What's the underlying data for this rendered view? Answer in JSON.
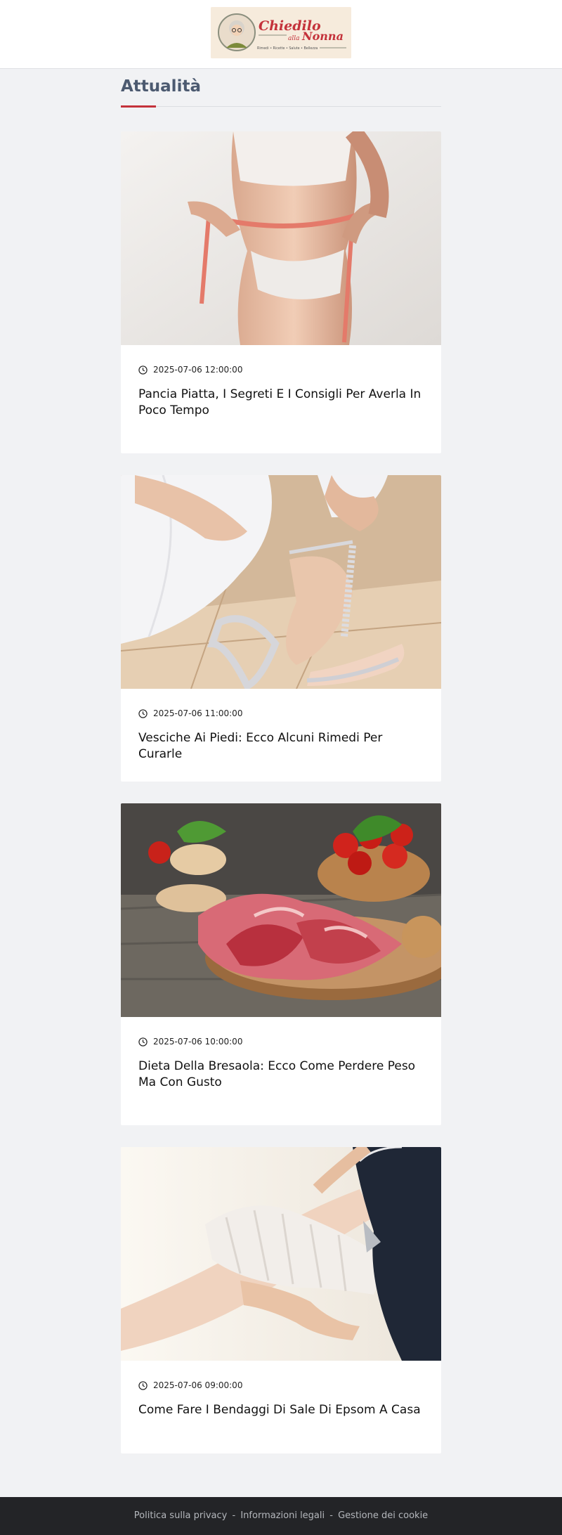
{
  "header": {
    "logo": {
      "title": "Chiedilo",
      "subtitle_small": "alla",
      "subtitle": "Nonna",
      "tagline": "Rimedi • Ricette • Salute • Bellezza",
      "colors": {
        "primary": "#c4323b",
        "background": "#f6ebdc"
      }
    }
  },
  "section": {
    "title": "Attualità"
  },
  "articles": [
    {
      "image_icon": "waist-measuring-tape-photo",
      "timestamp": "2025-07-06 12:00:00",
      "title": "Pancia Piatta, I Segreti E I Consigli Per Averla In Poco Tempo"
    },
    {
      "image_icon": "sandal-feet-photo",
      "timestamp": "2025-07-06 11:00:00",
      "title": "Vesciche Ai Piedi: Ecco Alcuni Rimedi Per Curarle"
    },
    {
      "image_icon": "cured-meat-platter-photo",
      "timestamp": "2025-07-06 10:00:00",
      "title": "Dieta Della Bresaola: Ecco Come Perdere Peso Ma Con Gusto"
    },
    {
      "image_icon": "leg-bandage-photo",
      "timestamp": "2025-07-06 09:00:00",
      "title": "Come Fare I Bendaggi Di Sale Di Epsom A Casa"
    }
  ],
  "footer": {
    "links": [
      "Politica sulla privacy",
      "Informazioni legali",
      "Gestione dei cookie"
    ],
    "separator": "-"
  },
  "colors": {
    "page_background": "#f1f2f4",
    "accent": "#c4323b",
    "section_title": "#4c5a70",
    "footer_background": "#232427"
  }
}
